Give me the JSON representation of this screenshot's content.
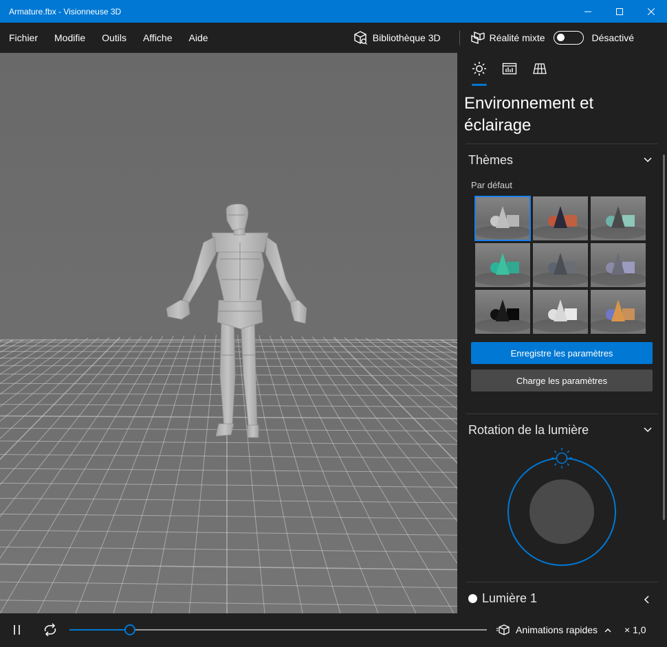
{
  "window": {
    "title": "Armature.fbx - Visionneuse 3D"
  },
  "menu": {
    "items": [
      "Fichier",
      "Modifie",
      "Outils",
      "Affiche",
      "Aide"
    ]
  },
  "toolbar": {
    "library_label": "Bibliothèque 3D",
    "mixed_reality_label": "Réalité mixte",
    "mixed_reality_state": "Désactivé",
    "mixed_reality_on": false
  },
  "panel": {
    "title": "Environnement et éclairage",
    "tabs": [
      "sun-icon",
      "stats-icon",
      "grid-icon"
    ],
    "themes": {
      "heading": "Thèmes",
      "subheading": "Par défaut",
      "selected_index": 0,
      "thumbnails": [
        {
          "colors": [
            "#c8c8c8",
            "#bdbdbd",
            "#b5b5b5"
          ]
        },
        {
          "colors": [
            "#c0563a",
            "#2a2a3a",
            "#c06040"
          ]
        },
        {
          "colors": [
            "#6fb3a8",
            "#4a4a4a",
            "#8cc7b8"
          ]
        },
        {
          "colors": [
            "#2bb39a",
            "#3dc0a0",
            "#33a890"
          ]
        },
        {
          "colors": [
            "#5b6470",
            "#4b4f55",
            "#6a6e74"
          ]
        },
        {
          "colors": [
            "#8a8aa6",
            "#6b6b7a",
            "#9b9bc0"
          ]
        },
        {
          "colors": [
            "#111111",
            "#1a1a1a",
            "#0a0a0a"
          ]
        },
        {
          "colors": [
            "#e0e0e0",
            "#d8d8d8",
            "#e8e8e8"
          ]
        },
        {
          "colors": [
            "#6f78c8",
            "#d9964a",
            "#c8905a"
          ]
        }
      ],
      "save_label": "Enregistre les paramètres",
      "load_label": "Charge les paramètres"
    },
    "rotation": {
      "heading": "Rotation de la lumière"
    },
    "light": {
      "label": "Lumière 1"
    }
  },
  "playback": {
    "progress": 0.145,
    "animations_label": "Animations rapides",
    "speed_label": "× 1,0"
  },
  "colors": {
    "accent": "#0078d4",
    "panel_bg": "#202020",
    "viewport_bg": "#6e6e6e"
  }
}
